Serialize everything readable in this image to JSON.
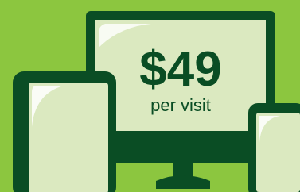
{
  "price": {
    "amount": "$49",
    "caption": "per visit"
  },
  "colors": {
    "background": "#8cc63f",
    "device_frame": "#0a4d24",
    "screen_fill": "#dbe9c0",
    "screen_highlight": "#ffffff"
  },
  "icons": [
    "desktop-monitor-icon",
    "tablet-icon",
    "phone-icon"
  ]
}
